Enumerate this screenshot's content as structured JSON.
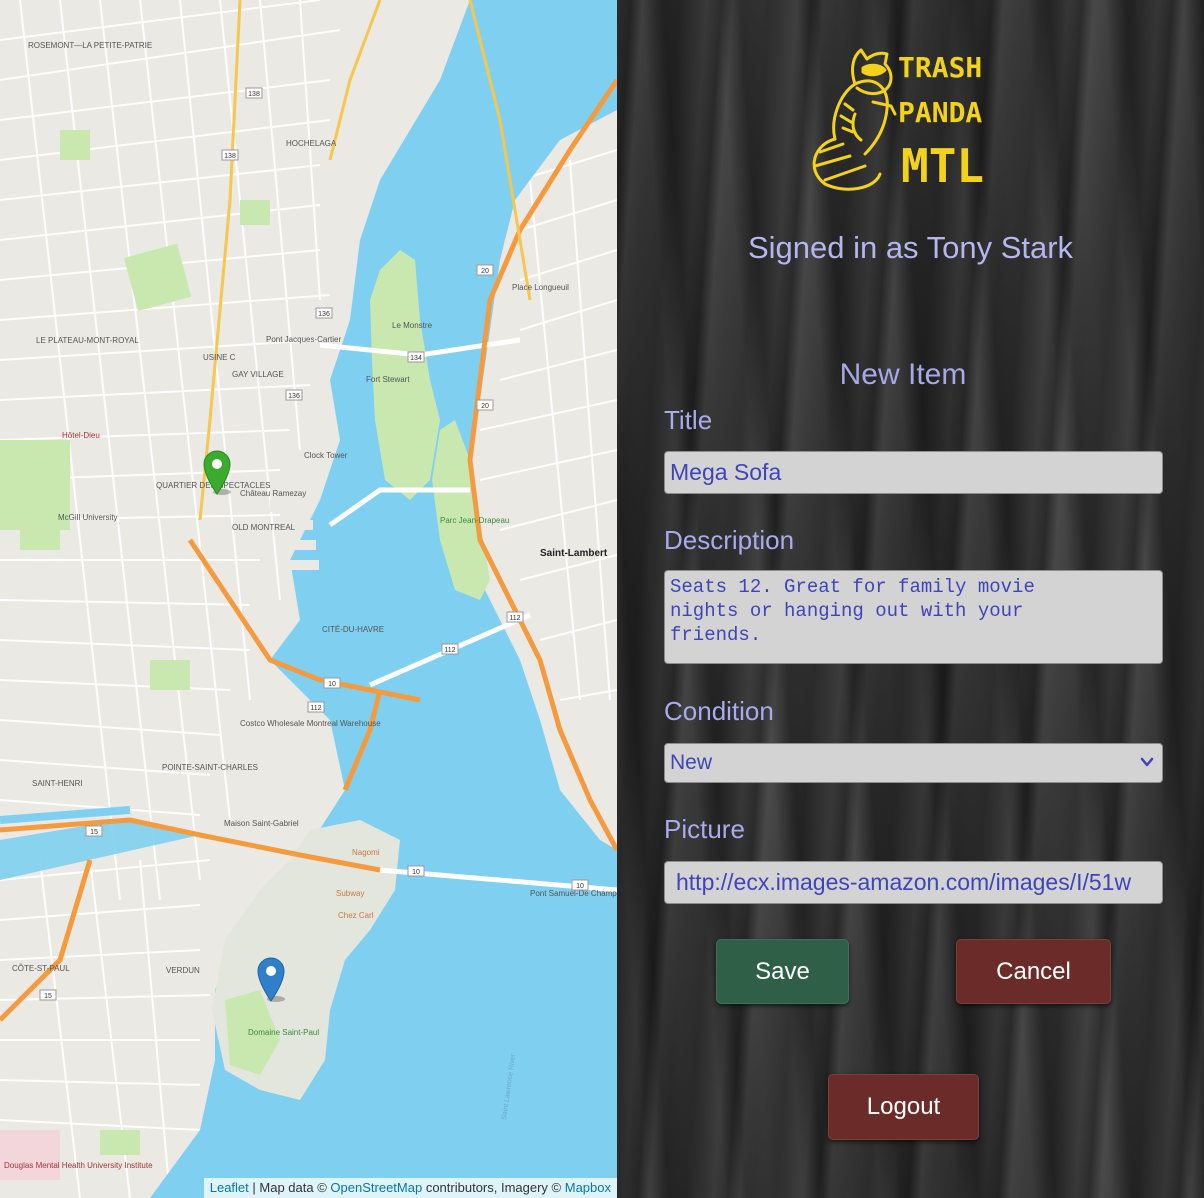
{
  "map": {
    "attribution": {
      "leaflet_label": "Leaflet",
      "map_data_prefix": "| Map data ©",
      "osm_label": "OpenStreetMap",
      "imagery_prefix": "contributors, Imagery ©",
      "mapbox_label": "Mapbox"
    },
    "labels": {
      "rosemont": "ROSEMONT—LA PETITE-PATRIE",
      "plateau": "LE PLATEAU-MONT-ROYAL",
      "hochelaga": "HOCHELAGA",
      "gay_village": "GAY VILLAGE",
      "quartier": "QUARTIER DES SPECTACLES",
      "old_montreal": "OLD MONTREAL",
      "cite_du_havre": "CITÉ-DU-HAVRE",
      "pointe_st_charles": "POINTE-SAINT-CHARLES",
      "st_henri": "SAINT-HENRI",
      "verdun": "VERDUN",
      "cote_st_paul": "CÔTE-ST-PAUL",
      "saint_lambert": "Saint-Lambert",
      "parc_jean_drapeau": "Parc Jean-Drapeau",
      "domaine_st_paul": "Domaine Saint-Paul",
      "saint_lawrence": "Saint Lawrence River",
      "chateau_ramezay": "Château Ramezay",
      "clock_tower": "Clock Tower",
      "fort_stewart": "Fort Stewart",
      "le_monstre": "Le Monstre",
      "metro_longueuil": "Place Longueuil",
      "pont_jacques_cartier": "Pont Jacques-Cartier",
      "usine_c": "USINE C",
      "mcgill": "McGill University",
      "hotel_dieu": "Hôtel-Dieu",
      "costco": "Costco Wholesale Montreal Warehouse",
      "maison_st_gabriel": "Maison Saint-Gabriel",
      "douglas": "Douglas Mental Health University Institute",
      "nagomi": "Nagomi",
      "subway": "Subway",
      "chez_carl": "Chez Carl",
      "pont_champlain": "Pont Samuel-De Champlain"
    },
    "shields": [
      "138",
      "138",
      "136",
      "136",
      "134",
      "112",
      "112",
      "112",
      "20",
      "20",
      "10",
      "10",
      "10",
      "15",
      "15"
    ]
  },
  "logo": {
    "line1": "TRASH",
    "line2": "PANDA",
    "line3": "MTL",
    "color": "#f2d21a"
  },
  "header": {
    "signed_in": "Signed in as Tony Stark"
  },
  "form": {
    "title": "New Item",
    "title_label": "Title",
    "title_value": "Mega Sofa",
    "description_label": "Description",
    "description_value": "Seats 12. Great for family movie\nnights or hanging out with your\nfriends.",
    "condition_label": "Condition",
    "condition_value": "New",
    "picture_label": "Picture",
    "picture_value": "http://ecx.images-amazon.com/images/I/51w",
    "save_label": "Save",
    "cancel_label": "Cancel",
    "logout_label": "Logout"
  },
  "colors": {
    "water": "#7fd0f0",
    "park": "#c9e8b0",
    "highway": "#f59a3f",
    "pin_green": "#3aab2d",
    "pin_blue": "#2f7fc9",
    "save_bg": "#2f5f47",
    "cancel_bg": "#6b2b28"
  }
}
